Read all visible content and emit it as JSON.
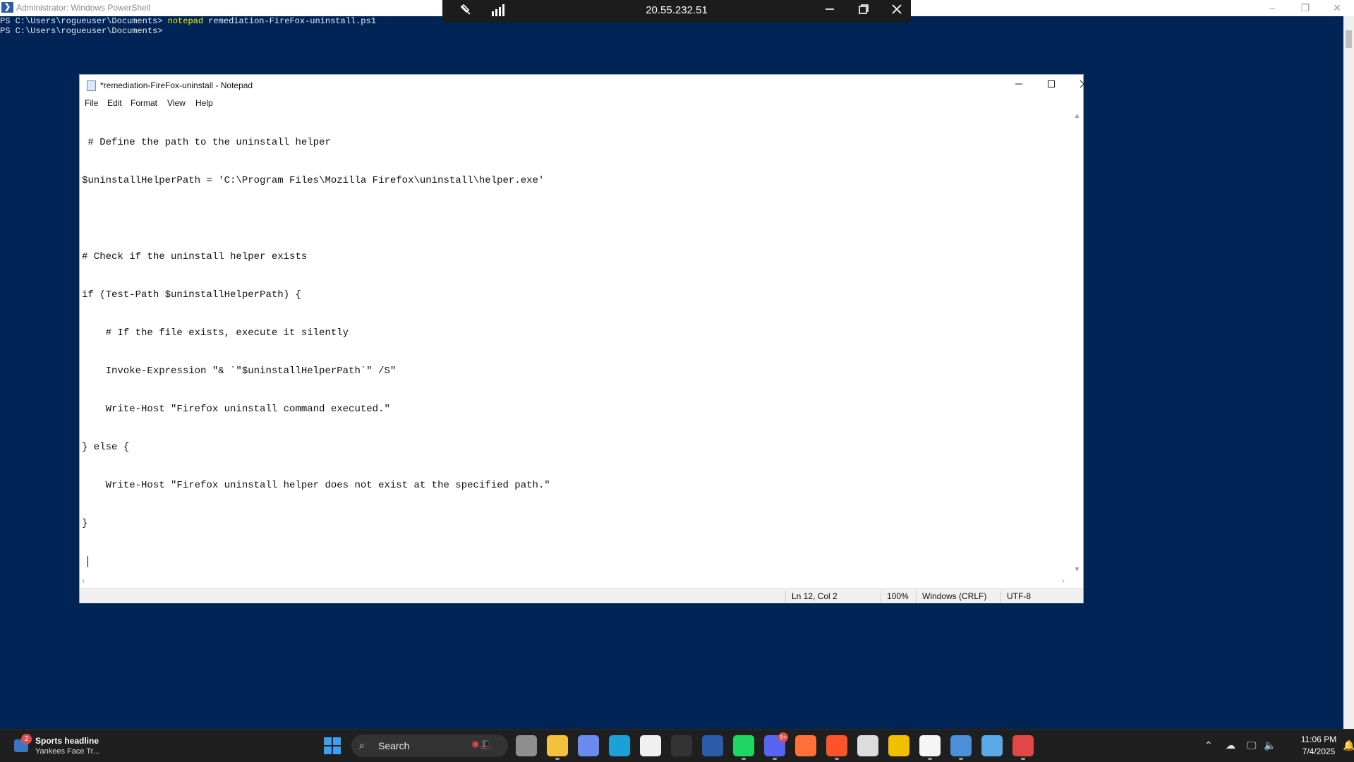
{
  "powershell": {
    "title": "Administrator: Windows PowerShell",
    "lines": [
      {
        "prompt": "PS C:\\Users\\rogueuser\\Documents> ",
        "command": "notepad",
        "args": " remediation-FireFox-uninstall.ps1"
      },
      {
        "prompt": "PS C:\\Users\\rogueuser\\Documents> ",
        "command": "",
        "args": ""
      }
    ],
    "controls": {
      "minimize": "–",
      "restore": "❐",
      "close": "✕"
    }
  },
  "rdp": {
    "host": "20.55.232.51",
    "pin_icon": "pin-off-icon",
    "signal_icon": "signal-bars-icon"
  },
  "notepad": {
    "title": "*remediation-FireFox-uninstall - Notepad",
    "menu": [
      "File",
      "Edit",
      "Format",
      "View",
      "Help"
    ],
    "lines": [
      " # Define the path to the uninstall helper",
      "$uninstallHelperPath = 'C:\\Program Files\\Mozilla Firefox\\uninstall\\helper.exe'",
      "",
      "# Check if the uninstall helper exists",
      "if (Test-Path $uninstallHelperPath) {",
      "    # If the file exists, execute it silently",
      "    Invoke-Expression \"& `\"$uninstallHelperPath`\" /S\"",
      "    Write-Host \"Firefox uninstall command executed.\"",
      "} else {",
      "    Write-Host \"Firefox uninstall helper does not exist at the specified path.\"",
      "}",
      " "
    ],
    "status": {
      "position": "Ln 12, Col 2",
      "zoom": "100%",
      "line_ending": "Windows (CRLF)",
      "encoding": "UTF-8"
    }
  },
  "taskbar": {
    "widget": {
      "badge": "2",
      "title": "Sports headline",
      "subtitle": "Yankees Face Tr..."
    },
    "search_label": "Search",
    "apps": [
      {
        "name": "task-view-icon",
        "color": "#8e8e8e"
      },
      {
        "name": "file-explorer-icon",
        "color": "#f3c23c"
      },
      {
        "name": "copilot-icon",
        "color": "#6a8cf0"
      },
      {
        "name": "edge-icon",
        "color": "#1ba0d8"
      },
      {
        "name": "store-icon",
        "color": "#f0f0f0"
      },
      {
        "name": "terminal-icon",
        "color": "#333333"
      },
      {
        "name": "powershell-icon",
        "color": "#2a5caa"
      },
      {
        "name": "spotify-icon",
        "color": "#1ed760"
      },
      {
        "name": "discord-icon",
        "color": "#5865f2"
      },
      {
        "name": "firefox-icon",
        "color": "#ff7139"
      },
      {
        "name": "brave-icon",
        "color": "#fb542b"
      },
      {
        "name": "clock-app-icon",
        "color": "#dcdcdc"
      },
      {
        "name": "tools-icon",
        "color": "#f0c000"
      },
      {
        "name": "notion-icon",
        "color": "#f5f5f5"
      },
      {
        "name": "remote-desktop-icon",
        "color": "#4c8ed9"
      },
      {
        "name": "notepad-icon",
        "color": "#5aa9e6"
      },
      {
        "name": "snipping-tool-icon",
        "color": "#e04848"
      }
    ],
    "discord_badge": "9+",
    "time": "11:06 PM",
    "date": "7/4/2025"
  }
}
